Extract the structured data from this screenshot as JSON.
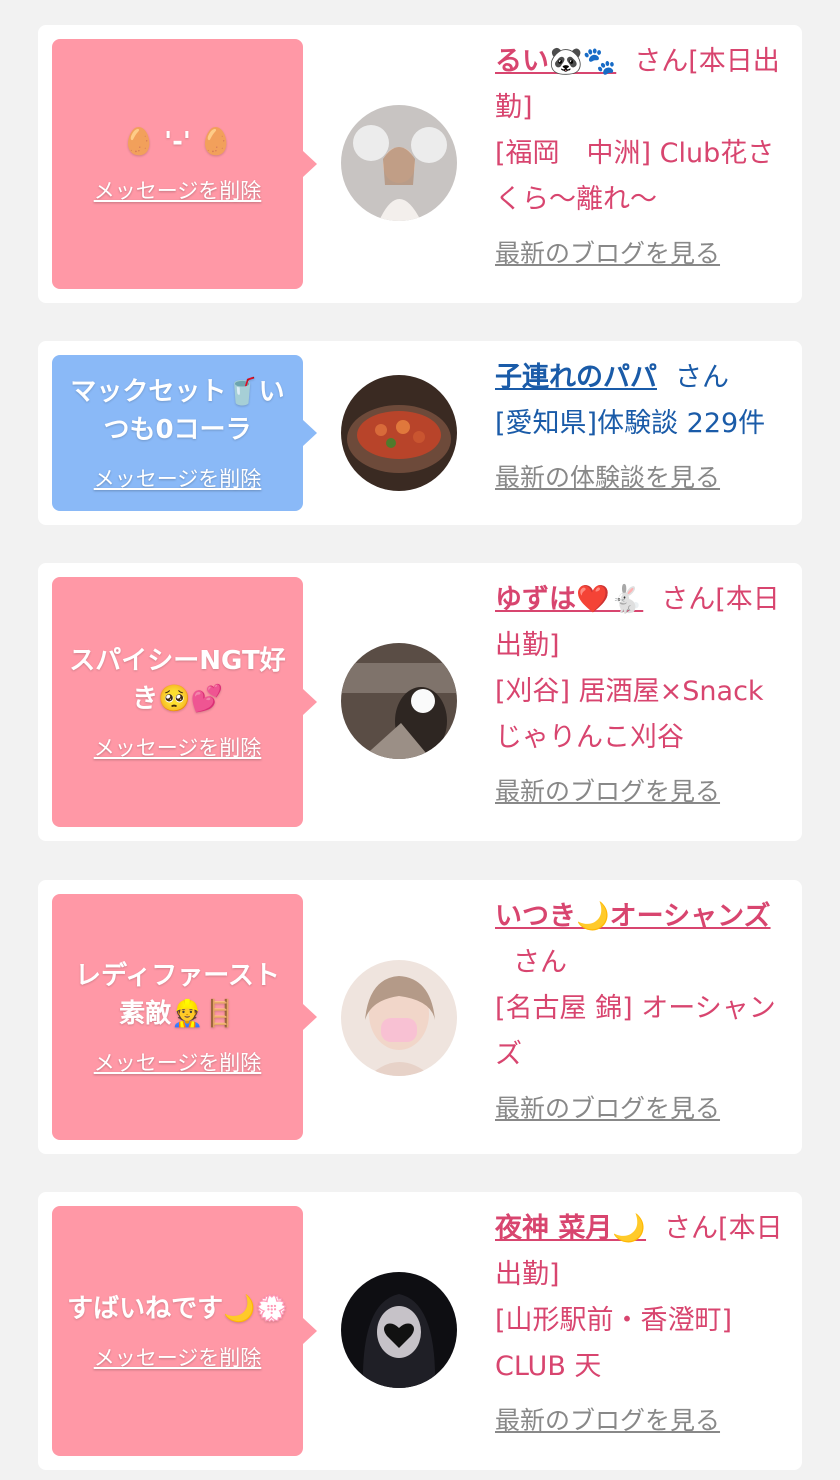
{
  "colors": {
    "bubble_pink": "#ff98a6",
    "bubble_blue": "#8ab9f7",
    "cast_text": "#d8456f",
    "user_text": "#1a5ba8",
    "link_gray": "#888888"
  },
  "delete_label": "メッセージを削除",
  "honorific": "さん",
  "items": [
    {
      "message": "🥚 '-' 🥚",
      "name": "るい🐼🐾",
      "status": "[本日出勤]",
      "shop": "[福岡　中洲] Club花さくら〜離れ〜",
      "link": "最新のブログを見る"
    },
    {
      "message": "マックセット🥤いつも0コーラ",
      "name": "子連れのパパ",
      "shop": "[愛知県]体験談 229件",
      "link": "最新の体験談を見る"
    },
    {
      "message": "スパイシーNGT好き🥺💕",
      "name": "ゆずは❤️🐇",
      "status": "[本日出勤]",
      "shop": "[刈谷] 居酒屋×Snack じゃりんこ刈谷",
      "link": "最新のブログを見る"
    },
    {
      "message": "レディファースト素敵👷🪜",
      "name": "いつき🌙オーシャンズ",
      "shop": "[名古屋 錦] オーシャンズ",
      "link": "最新のブログを見る"
    },
    {
      "message": "すばいねです🌙💮",
      "name": "夜神 菜月🌙",
      "status": "[本日出勤]",
      "shop": "[山形駅前・香澄町] CLUB 天",
      "link": "最新のブログを見る"
    }
  ]
}
